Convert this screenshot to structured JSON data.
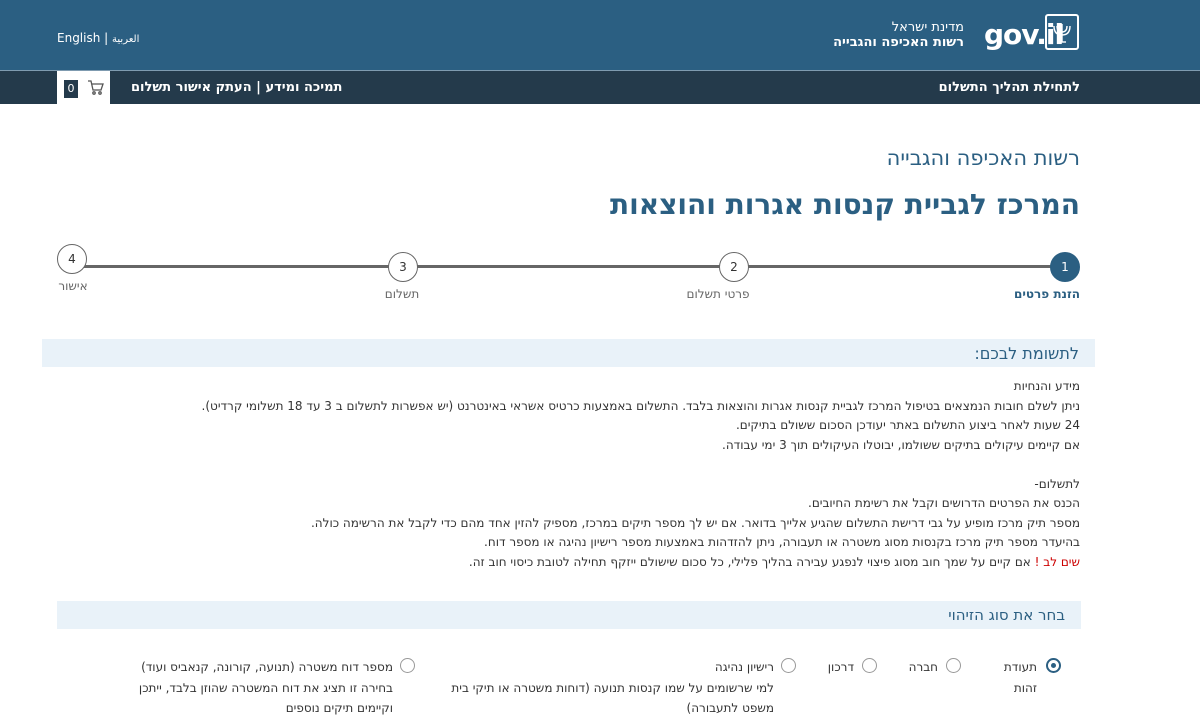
{
  "header": {
    "logo_text": "gov.il",
    "state_name": "מדינת ישראל",
    "authority_name": "רשות האכיפה והגבייה",
    "lang_arabic": "العربية",
    "lang_separator": "|",
    "lang_english": "English"
  },
  "nav": {
    "start_link": "לתחילת תהליך התשלום",
    "support_link": "תמיכה ומידע | העתק אישור תשלום",
    "cart_count": "0"
  },
  "page": {
    "subtitle": "רשות האכיפה והגבייה",
    "title": "המרכז לגביית קנסות אגרות והוצאות"
  },
  "steps": [
    {
      "number": "1",
      "label": "הזנת פרטים",
      "active": true
    },
    {
      "number": "2",
      "label": "פרטי תשלום",
      "active": false
    },
    {
      "number": "3",
      "label": "תשלום",
      "active": false
    },
    {
      "number": "4",
      "label": "אישור",
      "active": false
    }
  ],
  "notice": {
    "title": "לתשומת לבכם:",
    "lines": [
      "מידע והנחיות",
      "ניתן לשלם חובות הנמצאים בטיפול המרכז לגביית קנסות אגרות והוצאות בלבד. התשלום באמצעות כרטיס אשראי באינטרנט (יש אפשרות לתשלום ב 3 עד 18 תשלומי קרדיט).",
      "24 שעות לאחר ביצוע התשלום באתר יעודכן הסכום ששולם בתיקים.",
      "אם קיימים עיקולים בתיקים ששולמו, יבוטלו העיקולים תוך 3 ימי עבודה.",
      "",
      "לתשלום-",
      "הכנס את הפרטים הדרושים וקבל את רשימת החיובים.",
      "מספר תיק מרכז מופיע על גבי דרישת התשלום שהגיע אלייך בדואר. אם יש לך מספר תיקים במרכז, מספיק להזין אחד מהם כדי לקבל את הרשימה כולה.",
      "בהיעדר מספר תיק מרכז בקנסות מסוג משטרה או תעבורה, ניתן להזדהות באמצעות מספר רישיון נהיגה או מספר דוח."
    ],
    "warning_prefix": "שים לב !",
    "warning_text": " אם קיים על שמך חוב מסוג פיצוי לנפגע עבירה בהליך פלילי, כל סכום שישולם ייזקף תחילה לטובת כיסוי חוב זה."
  },
  "id_type": {
    "title": "בחר את סוג הזיהוי",
    "options": [
      {
        "label": "תעודת",
        "label2": "זהות",
        "checked": true
      },
      {
        "label": "חברה",
        "checked": false
      },
      {
        "label": "דרכון",
        "checked": false
      },
      {
        "label": "רישיון נהיגה",
        "checked": false,
        "desc1": "למי שרשומים על שמו קנסות תנועה (דוחות משטרה או תיקי בית",
        "desc2": "משפט לתעבורה)"
      },
      {
        "label": "מספר דוח משטרה (תנועה, קורונה, קנאביס ועוד)",
        "checked": false,
        "desc1": "בחירה זו תציג את דוח המשטרה שהוזן בלבד, ייתכן",
        "desc2": "וקיימים תיקים נוספים"
      }
    ]
  }
}
